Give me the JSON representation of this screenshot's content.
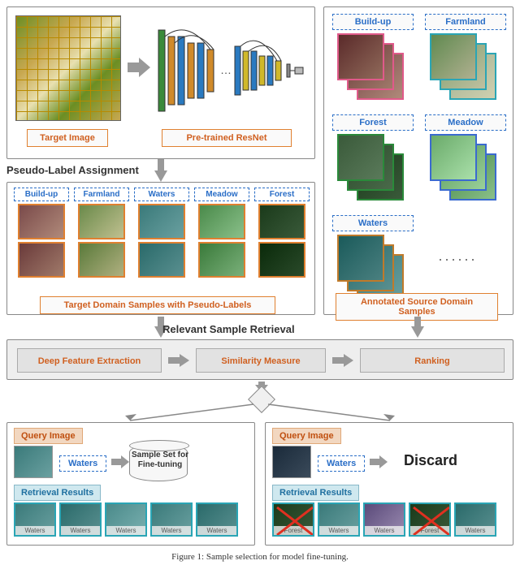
{
  "top": {
    "target_label": "Target Image",
    "resnet_label": "Pre-trained ResNet"
  },
  "pseudo": {
    "heading": "Pseudo-Label Assignment",
    "caption": "Target Domain Samples with Pseudo-Labels",
    "classes": [
      "Build-up",
      "Farmland",
      "Waters",
      "Meadow",
      "Forest"
    ]
  },
  "source": {
    "caption": "Annotated Source Domain Samples",
    "groups": [
      {
        "name": "Build-up",
        "color": "#e05a8a"
      },
      {
        "name": "Farmland",
        "color": "#2aa5b5"
      },
      {
        "name": "Forest",
        "color": "#2a8a3a"
      },
      {
        "name": "Meadow",
        "color": "#3a6ad0"
      },
      {
        "name": "Waters",
        "color": "#c07a2a"
      }
    ]
  },
  "retrieval": {
    "heading": "Relevant Sample Retrieval",
    "steps": [
      "Deep Feature Extraction",
      "Similarity Measure",
      "Ranking"
    ]
  },
  "bottom": {
    "query_label": "Query Image",
    "retrieval_label": "Retrieval Results",
    "left": {
      "category": "Waters",
      "action": "Sample Set for Fine-tuning",
      "results": [
        "Waters",
        "Waters",
        "Waters",
        "Waters",
        "Waters"
      ],
      "crossed": [
        false,
        false,
        false,
        false,
        false
      ]
    },
    "right": {
      "category": "Waters",
      "action": "Discard",
      "results": [
        "Forest",
        "Waters",
        "Waters",
        "Forest",
        "Waters"
      ],
      "crossed": [
        true,
        false,
        false,
        true,
        false
      ]
    }
  },
  "caption": "Figure 1: Sample selection for model fine-tuning.",
  "tile_colors": {
    "Build-up": "linear-gradient(135deg,#7a4a4a,#b08a7a,#5a3a3a)",
    "Farmland": "linear-gradient(135deg,#6a8a4a,#c0c090,#4a6a3a)",
    "Waters": "linear-gradient(135deg,#3a7a7a,#6aa0a0,#2a5a5a)",
    "Meadow": "linear-gradient(135deg,#4a8a4a,#8ac08a,#3a6a3a)",
    "Forest": "linear-gradient(135deg,#1a3a1a,#3a5a3a,#0a2a0a)"
  }
}
